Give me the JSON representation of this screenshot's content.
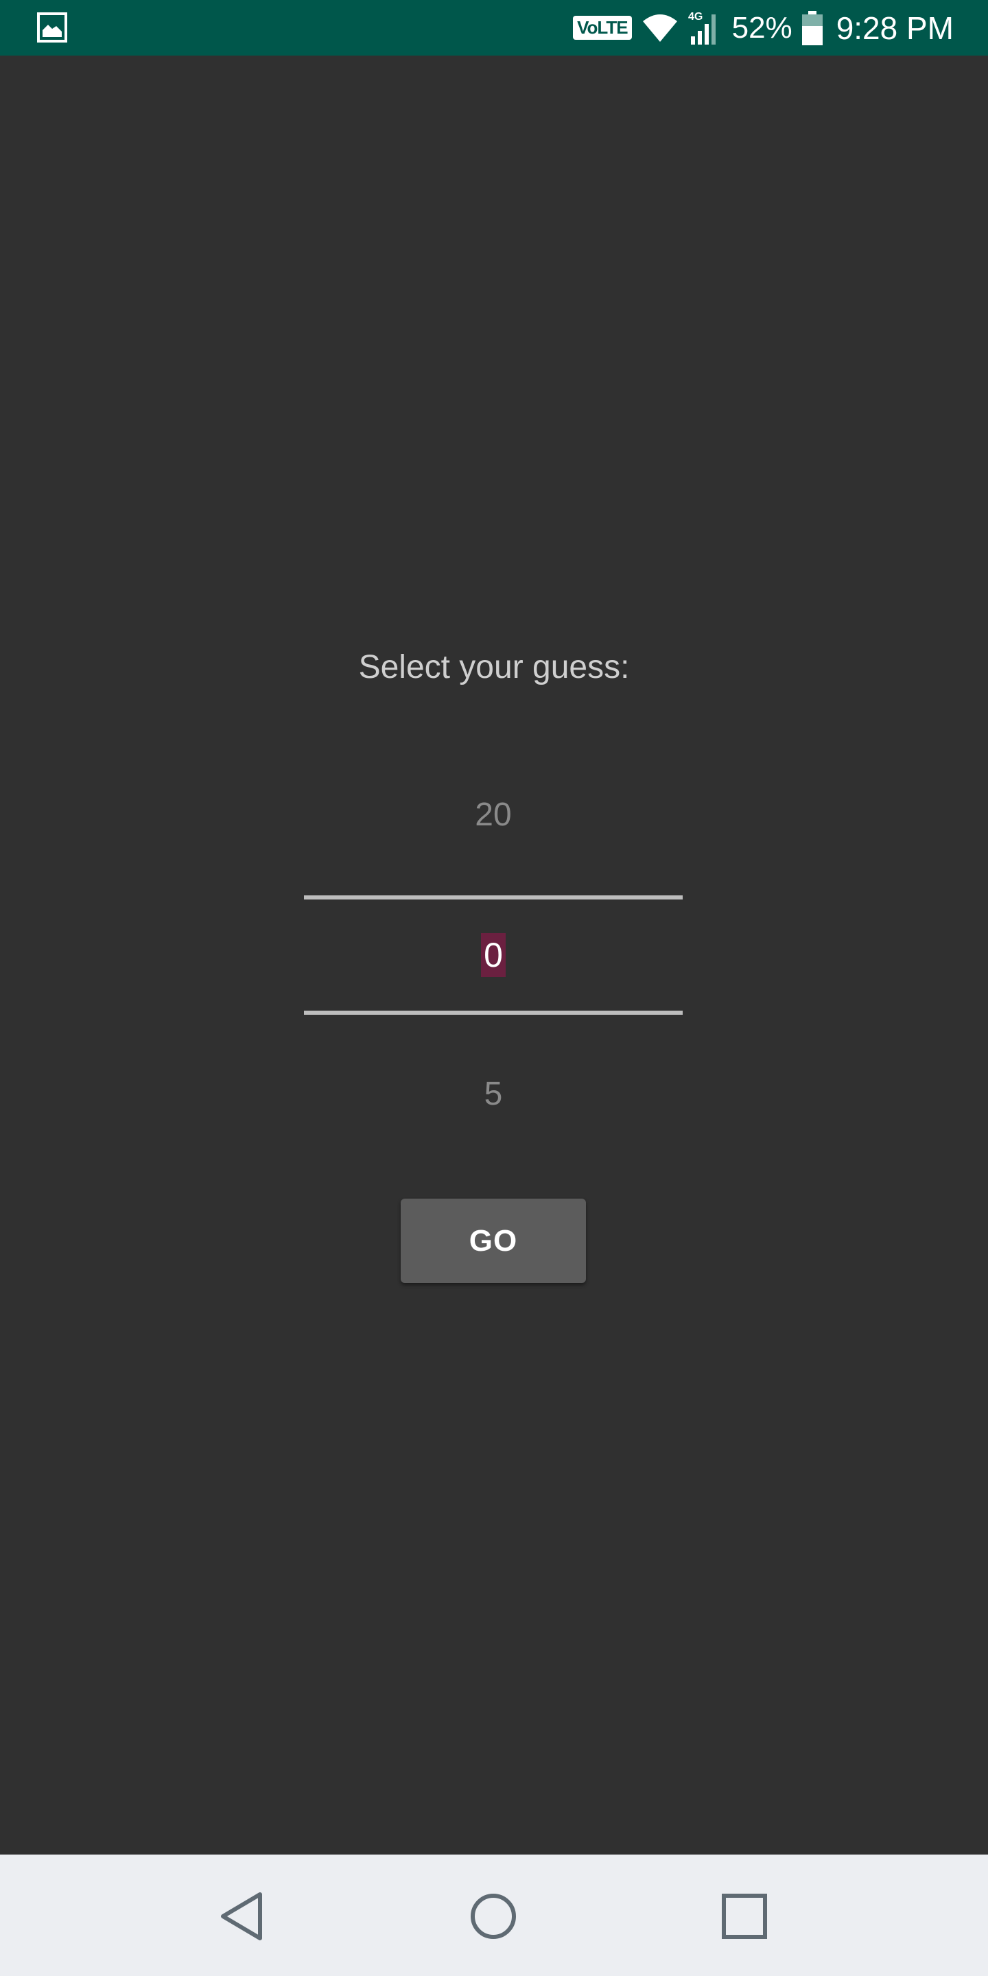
{
  "status_bar": {
    "notification_icon": "gallery-icon",
    "network_badge": "VoLTE",
    "wifi_icon": "wifi-icon",
    "signal_icon": "signal-4g-icon",
    "signal_label": "4G",
    "battery_percent": "52%",
    "battery_icon": "battery-icon",
    "time": "9:28 PM",
    "background_color": "#00574B"
  },
  "main": {
    "prompt": "Select your guess:",
    "picker": {
      "previous_value": "20",
      "current_value": "0",
      "next_value": "5",
      "highlight_color": "#6B2040"
    },
    "go_button_label": "GO"
  },
  "nav_bar": {
    "back_icon": "back-triangle-icon",
    "home_icon": "home-circle-icon",
    "recents_icon": "recents-square-icon"
  }
}
